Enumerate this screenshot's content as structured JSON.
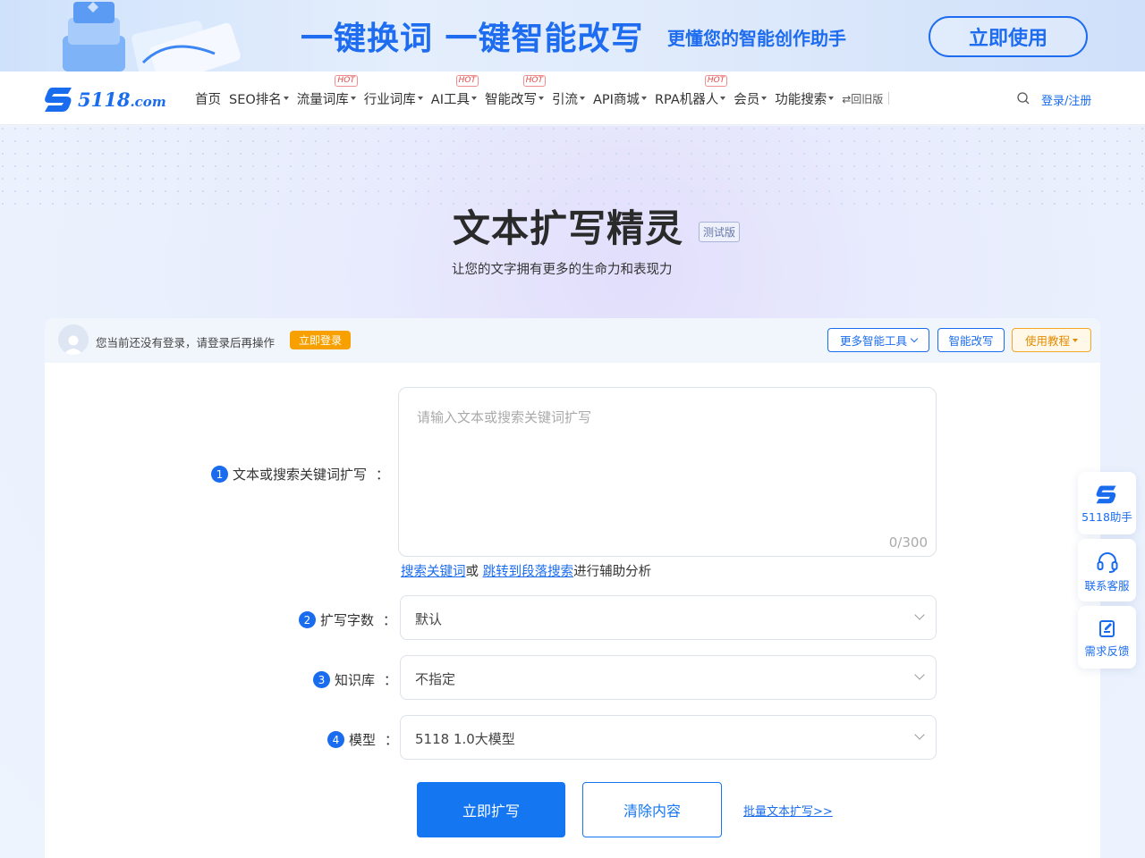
{
  "banner": {
    "headline": "一键换词 一键智能改写",
    "subline": "更懂您的智能创作助手",
    "cta": "立即使用"
  },
  "nav": {
    "logo_main": "5118",
    "logo_suffix": ".com",
    "items": [
      {
        "label": "首页",
        "dropdown": false,
        "hot": false
      },
      {
        "label": "SEO排名",
        "dropdown": true,
        "hot": false
      },
      {
        "label": "流量词库",
        "dropdown": true,
        "hot": true
      },
      {
        "label": "行业词库",
        "dropdown": true,
        "hot": false
      },
      {
        "label": "AI工具",
        "dropdown": true,
        "hot": true
      },
      {
        "label": "智能改写",
        "dropdown": true,
        "hot": true
      },
      {
        "label": "引流",
        "dropdown": true,
        "hot": false
      },
      {
        "label": "API商城",
        "dropdown": true,
        "hot": false
      },
      {
        "label": "RPA机器人",
        "dropdown": true,
        "hot": true
      },
      {
        "label": "会员",
        "dropdown": true,
        "hot": false
      },
      {
        "label": "功能搜索",
        "dropdown": true,
        "hot": false
      }
    ],
    "hot_badge": "HOT",
    "old_version": "⇄回旧版",
    "login": "登录/注册"
  },
  "hero": {
    "title": "文本扩写精灵",
    "badge": "测试版",
    "subtitle": "让您的文字拥有更多的生命力和表现力"
  },
  "panel": {
    "login_hint": "您当前还没有登录，请登录后再操作",
    "login_button": "立即登录",
    "more_tools": "更多智能工具",
    "rewrite": "智能改写",
    "tutorial": "使用教程"
  },
  "form": {
    "colon": "：",
    "field1": {
      "num": "1",
      "label": "文本或搜索关键词扩写",
      "placeholder": "请输入文本或搜索关键词扩写",
      "counter": "0/300"
    },
    "aux": {
      "link1": "搜索关键词",
      "or": "或",
      "link2": "跳转到段落搜索",
      "tail": "进行辅助分析"
    },
    "field2": {
      "num": "2",
      "label": "扩写字数",
      "value": "默认"
    },
    "field3": {
      "num": "3",
      "label": "知识库",
      "value": "不指定"
    },
    "field4": {
      "num": "4",
      "label": "模型",
      "value": "5118 1.0大模型"
    },
    "submit": "立即扩写",
    "clear": "清除内容",
    "batch": "批量文本扩写>>"
  },
  "float": {
    "assistant": "5118助手",
    "service": "联系客服",
    "feedback": "需求反馈"
  },
  "colors": {
    "primary": "#1477f1",
    "brand": "#1a6cee",
    "orange": "#f7a000",
    "hot": "#e94a4a"
  }
}
